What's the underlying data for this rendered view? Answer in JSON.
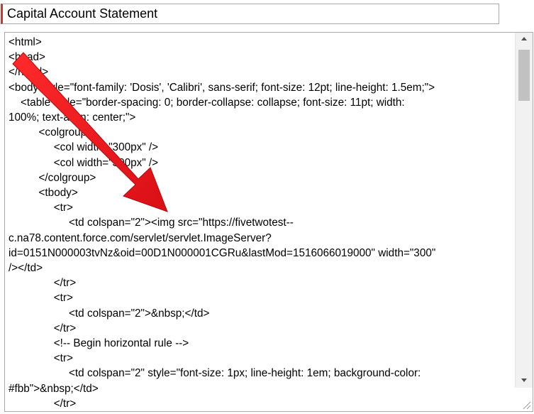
{
  "title_field": {
    "value": "Capital Account Statement"
  },
  "editor": {
    "lines": [
      "<html>",
      "<head>",
      "</head>",
      "<body style=\"font-family: 'Dosis', 'Calibri', sans-serif; font-size: 12pt; line-height: 1.5em;\">",
      "    <table style=\"border-spacing: 0; border-collapse: collapse; font-size: 11pt; width:",
      "100%; text-align: center;\">",
      "          <colgroup>",
      "               <col width=\"300px\" />",
      "               <col width=\"300px\" />",
      "          </colgroup>",
      "          <tbody>",
      "               <tr>",
      "                    <td colspan=\"2\"><img src=\"https://fivetwotest--",
      "c.na78.content.force.com/servlet/servlet.ImageServer?",
      "id=0151N000003tvNz&oid=00D1N000001CGRu&lastMod=1516066019000\" width=\"300\"",
      "/></td>",
      "               </tr>",
      "               <tr>",
      "                    <td colspan=\"2\">&nbsp;</td>",
      "               </tr>",
      "               <!-- Begin horizontal rule -->",
      "               <tr>",
      "                    <td colspan=\"2\" style=\"font-size: 1px; line-height: 1em; background-color:",
      "#fbb\">&nbsp;</td>",
      "               </tr>"
    ]
  },
  "annotation": {
    "arrow_color": "#e8141c"
  },
  "colors": {
    "required_bar": "#c23934",
    "scroll_thumb": "#c1c1c1",
    "scroll_track": "#f1f1f1"
  }
}
